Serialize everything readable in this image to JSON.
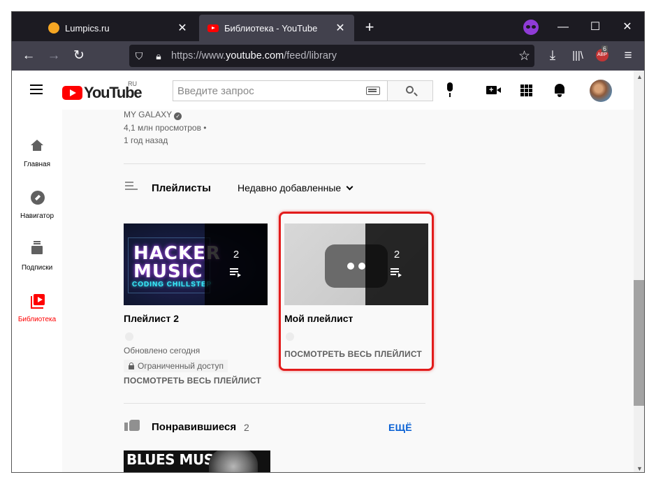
{
  "browser": {
    "tabs": [
      {
        "label": "Lumpics.ru",
        "active": false
      },
      {
        "label": "Библиотека - YouTube",
        "active": true
      }
    ],
    "new_tab": "+",
    "url": {
      "scheme": "https://www.",
      "host": "youtube.com",
      "path": "/feed/library"
    },
    "abp_badge": "ABP",
    "abp_count": "6"
  },
  "masthead": {
    "logo_text": "YouTube",
    "region": "RU",
    "search_placeholder": "Введите запрос"
  },
  "guide": [
    {
      "label": "Главная",
      "icon": "home-icon"
    },
    {
      "label": "Навигатор",
      "icon": "compass-icon"
    },
    {
      "label": "Подписки",
      "icon": "subscriptions-icon"
    },
    {
      "label": "Библиотека",
      "icon": "library-icon",
      "active": true
    }
  ],
  "history_tail": {
    "channel": "MY GALAXY",
    "views": "4,1 млн просмотров •",
    "age": "1 год назад"
  },
  "playlists": {
    "title": "Плейлисты",
    "sort_label": "Недавно добавленные",
    "items": [
      {
        "title": "Плейлист 2",
        "count": "2",
        "thumb_title": "HACKER MUSIC",
        "thumb_subtitle": "CODING CHILLSTEP",
        "updated": "Обновлено сегодня",
        "privacy": "Ограниченный доступ",
        "link": "ПОСМОТРЕТЬ ВЕСЬ ПЛЕЙЛИСТ"
      },
      {
        "title": "Мой плейлист",
        "count": "2",
        "link": "ПОСМОТРЕТЬ ВЕСЬ ПЛЕЙЛИСТ"
      }
    ]
  },
  "liked": {
    "title": "Понравившиеся",
    "count": "2",
    "more": "ЕЩЁ",
    "thumb_title": "BLUES MUSIC"
  }
}
